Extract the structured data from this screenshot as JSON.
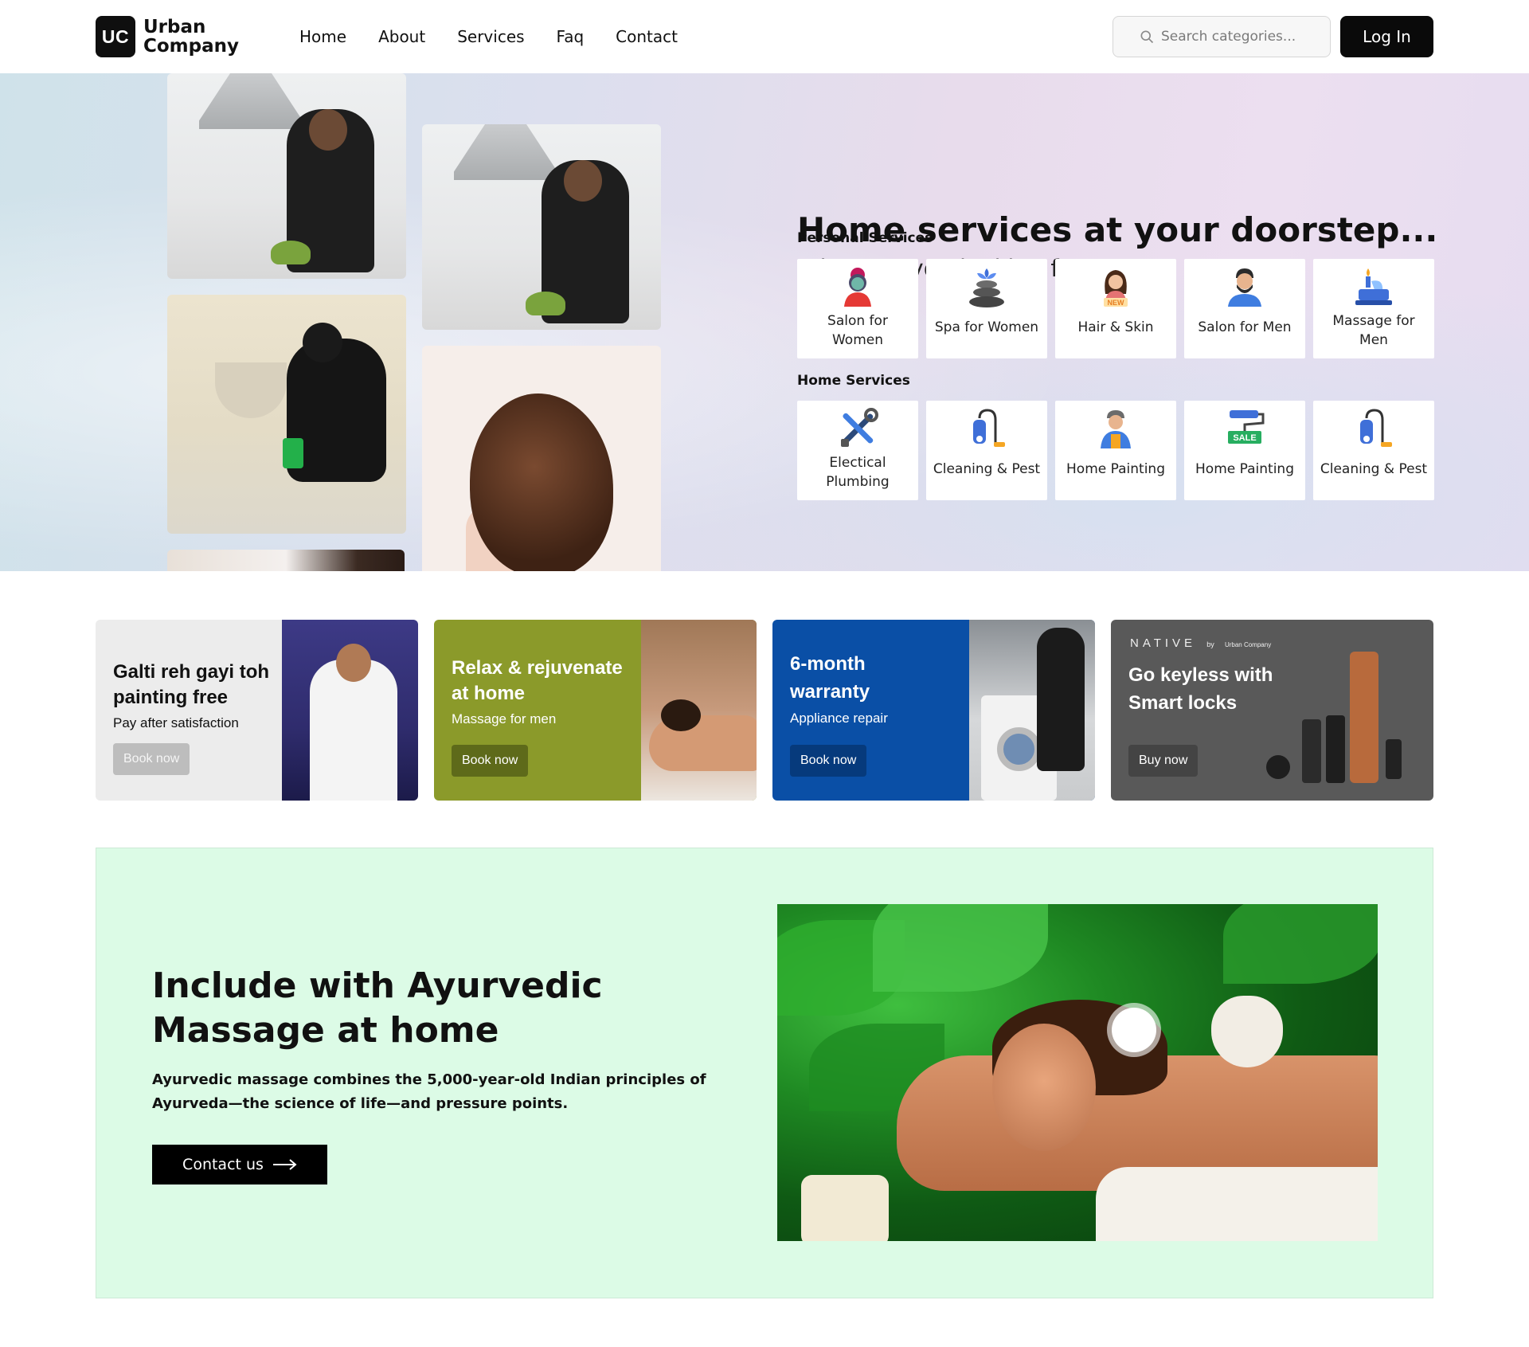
{
  "header": {
    "logo_mark": "UC",
    "logo_line1": "Urban",
    "logo_line2": "Company",
    "nav": [
      "Home",
      "About",
      "Services",
      "Faq",
      "Contact"
    ],
    "search_placeholder": "Search categories...",
    "login_label": "Log In"
  },
  "hero": {
    "title": "Home services at your doorstep...",
    "subtitle": "What are you looking for?",
    "personal_label": "Personal Services",
    "personal": [
      {
        "label": "Salon for Women",
        "icon": "salon-women-icon"
      },
      {
        "label": "Spa for Women",
        "icon": "spa-stones-icon"
      },
      {
        "label": "Hair & Skin",
        "icon": "hair-skin-icon",
        "badge": "NEW"
      },
      {
        "label": "Salon for Men",
        "icon": "salon-men-icon"
      },
      {
        "label": "Massage for Men",
        "icon": "massage-men-icon"
      }
    ],
    "home_label": "Home Services",
    "home": [
      {
        "label": "Electical Plumbing",
        "icon": "tools-icon"
      },
      {
        "label": "Cleaning & Pest",
        "icon": "vacuum-icon"
      },
      {
        "label": "Home Painting",
        "icon": "painter-icon"
      },
      {
        "label": "Home Painting",
        "icon": "paint-roller-icon",
        "badge": "SALE"
      },
      {
        "label": "Cleaning & Pest",
        "icon": "vacuum-icon"
      }
    ]
  },
  "promos": [
    {
      "title": "Galti reh gayi toh painting free",
      "sub": "Pay after satisfaction",
      "button": "Book now"
    },
    {
      "title": "Relax & rejuvenate at home",
      "sub": "Massage for men",
      "button": "Book now"
    },
    {
      "title": "6-month warranty",
      "sub": "Appliance repair",
      "button": "Book now"
    },
    {
      "brand": "NATIVE",
      "brand_by": "by",
      "brand_company": "Urban Company",
      "title": "Go keyless with Smart locks",
      "button": "Buy now"
    }
  ],
  "ayurvedic": {
    "title": "Include with Ayurvedic Massage at home",
    "description": "Ayurvedic massage combines the 5,000-year-old Indian principles of Ayurveda—the science of life—and pressure points.",
    "button": "Contact us"
  },
  "colors": {
    "accent": "#000000",
    "promo_grey": "#ececec",
    "promo_olive": "#8b9a2a",
    "promo_blue": "#0a4fa6",
    "promo_dark": "#595959",
    "ayur_bg": "#dcfbe6"
  }
}
